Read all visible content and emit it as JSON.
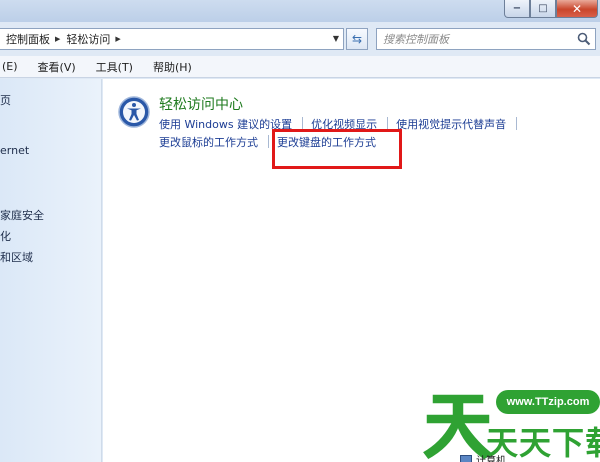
{
  "window": {
    "caption_minimize": "−",
    "caption_maximize": "□",
    "caption_close": "✕"
  },
  "address": {
    "crumbs": [
      "控制面板",
      "轻松访问"
    ],
    "search_placeholder": "搜索控制面板"
  },
  "menu": {
    "items": [
      "(E)",
      "查看(V)",
      "工具(T)",
      "帮助(H)"
    ]
  },
  "nav": {
    "items": [
      "页",
      "ernet",
      "家庭安全",
      "化",
      "和区域"
    ]
  },
  "main": {
    "category_title": "轻松访问中心",
    "row1_links": [
      "使用 Windows 建议的设置",
      "优化视频显示",
      "使用视觉提示代替声音"
    ],
    "row2_links": [
      "更改鼠标的工作方式",
      "更改键盘的工作方式"
    ]
  },
  "watermark": {
    "url": "www.TTzip.com",
    "text": "天天下载"
  },
  "taskbar": {
    "computer_label": "计算机"
  },
  "colors": {
    "category_green": "#1e7a1e",
    "link_blue": "#1c3d94",
    "highlight_red": "#e11818",
    "watermark_green": "#2fa233"
  }
}
